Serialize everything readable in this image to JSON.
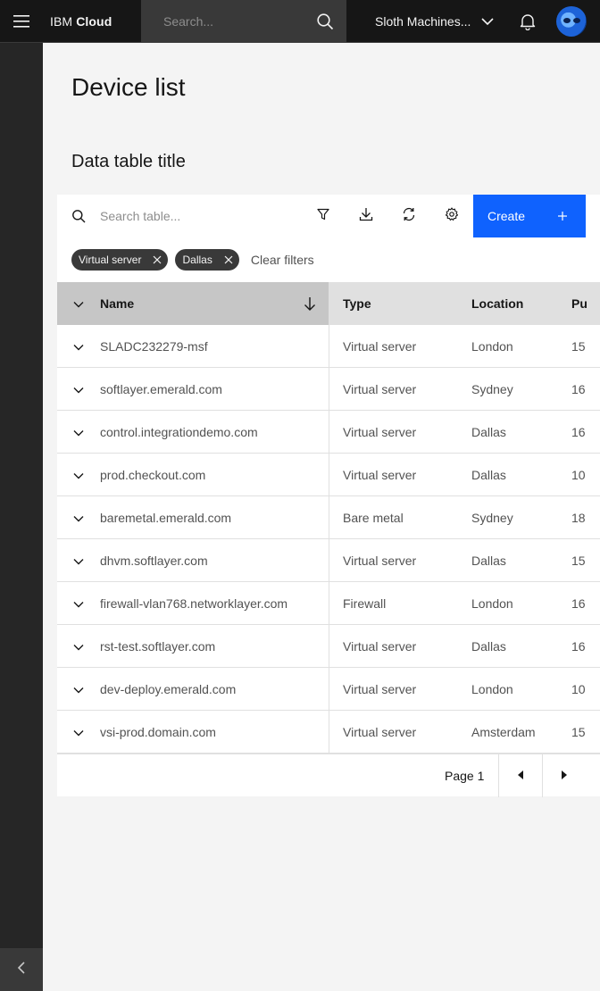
{
  "header": {
    "brand_prefix": "IBM",
    "brand_name": "Cloud",
    "search_placeholder": "Search...",
    "account_name": "Sloth Machines..."
  },
  "page": {
    "title": "Device list"
  },
  "table": {
    "title": "Data table title",
    "search_placeholder": "Search table...",
    "create_label": "Create",
    "filters": [
      "Virtual server",
      "Dallas"
    ],
    "clear_filters_label": "Clear filters",
    "columns": [
      "Name",
      "Type",
      "Location",
      "Pu"
    ],
    "rows": [
      {
        "name": "SLADC232279-msf",
        "type": "Virtual server",
        "location": "London",
        "pub": "15"
      },
      {
        "name": "softlayer.emerald.com",
        "type": "Virtual server",
        "location": "Sydney",
        "pub": "16"
      },
      {
        "name": "control.integrationdemo.com",
        "type": "Virtual server",
        "location": "Dallas",
        "pub": "16"
      },
      {
        "name": "prod.checkout.com",
        "type": "Virtual server",
        "location": "Dallas",
        "pub": "10"
      },
      {
        "name": "baremetal.emerald.com",
        "type": "Bare metal",
        "location": "Sydney",
        "pub": "18"
      },
      {
        "name": "dhvm.softlayer.com",
        "type": "Virtual server",
        "location": "Dallas",
        "pub": "15"
      },
      {
        "name": "firewall-vlan768.networklayer.com",
        "type": "Firewall",
        "location": "London",
        "pub": "16"
      },
      {
        "name": "rst-test.softlayer.com",
        "type": "Virtual server",
        "location": "Dallas",
        "pub": "16"
      },
      {
        "name": "dev-deploy.emerald.com",
        "type": "Virtual server",
        "location": "London",
        "pub": "10"
      },
      {
        "name": "vsi-prod.domain.com",
        "type": "Virtual server",
        "location": "Amsterdam",
        "pub": "15"
      }
    ],
    "pagination_label": "Page 1"
  },
  "colors": {
    "header_bg": "#161616",
    "rail_bg": "#262626",
    "accent": "#0f62fe",
    "page_bg": "#f4f4f4"
  }
}
